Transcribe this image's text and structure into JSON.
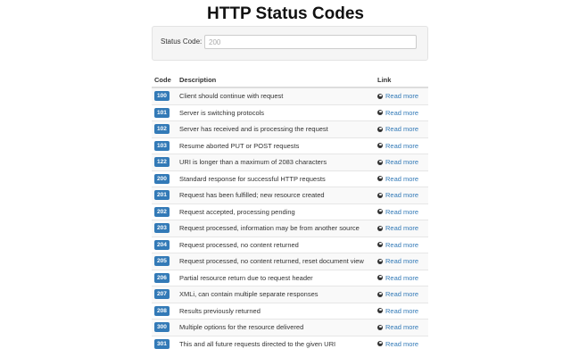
{
  "title": "HTTP Status Codes",
  "filter": {
    "label": "Status Code:",
    "placeholder": "200",
    "value": ""
  },
  "table": {
    "headers": {
      "code": "Code",
      "description": "Description",
      "link": "Link"
    },
    "rows": [
      {
        "code": "100",
        "description": "Client should continue with request",
        "link": "Read more"
      },
      {
        "code": "101",
        "description": "Server is switching protocols",
        "link": "Read more"
      },
      {
        "code": "102",
        "description": "Server has received and is processing the request",
        "link": "Read more"
      },
      {
        "code": "103",
        "description": "Resume aborted PUT or POST requests",
        "link": "Read more"
      },
      {
        "code": "122",
        "description": "URI is longer than a maximum of 2083 characters",
        "link": "Read more"
      },
      {
        "code": "200",
        "description": "Standard response for successful HTTP requests",
        "link": "Read more"
      },
      {
        "code": "201",
        "description": "Request has been fulfilled; new resource created",
        "link": "Read more"
      },
      {
        "code": "202",
        "description": "Request accepted, processing pending",
        "link": "Read more"
      },
      {
        "code": "203",
        "description": "Request processed, information may be from another source",
        "link": "Read more"
      },
      {
        "code": "204",
        "description": "Request processed, no content returned",
        "link": "Read more"
      },
      {
        "code": "205",
        "description": "Request processed, no content returned, reset document view",
        "link": "Read more"
      },
      {
        "code": "206",
        "description": "Partial resource return due to request header",
        "link": "Read more"
      },
      {
        "code": "207",
        "description": "XMLi, can contain multiple separate responses",
        "link": "Read more"
      },
      {
        "code": "208",
        "description": "Results previously returned",
        "link": "Read more"
      },
      {
        "code": "300",
        "description": "Multiple options for the resource delivered",
        "link": "Read more"
      },
      {
        "code": "301",
        "description": "This and all future requests directed to the given URI",
        "link": "Read more"
      }
    ]
  },
  "icons": {
    "link_icon": "globe-icon"
  },
  "colors": {
    "badge": "#337ab7",
    "link": "#337ab7"
  }
}
